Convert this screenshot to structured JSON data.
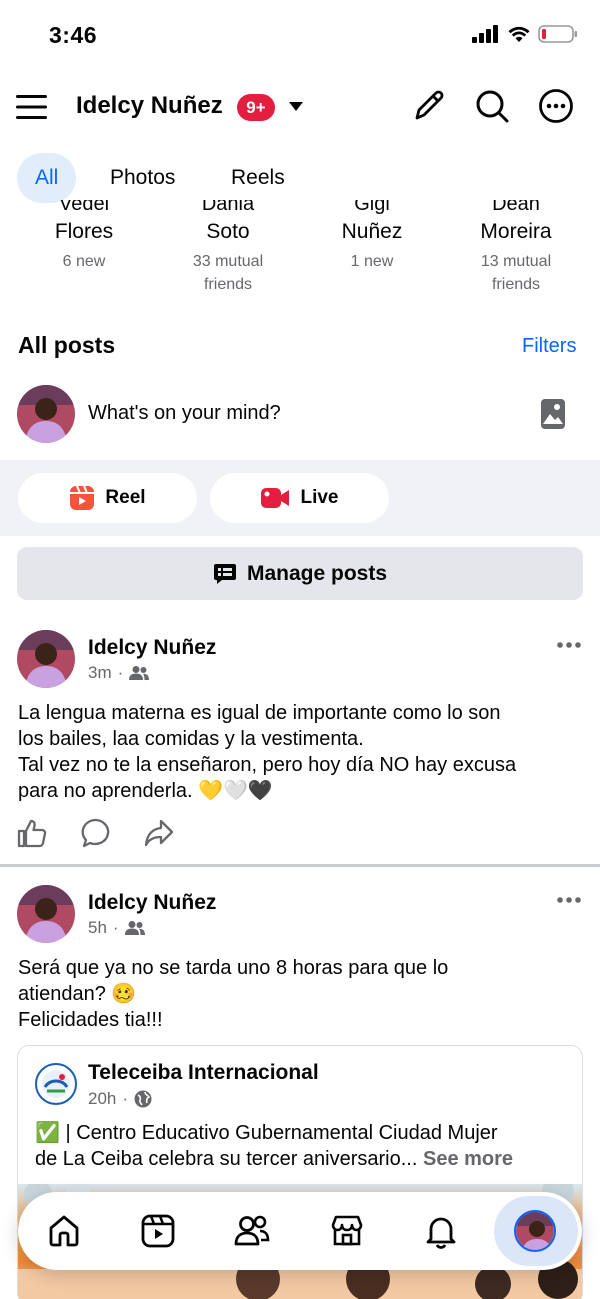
{
  "status_bar": {
    "time": "3:46"
  },
  "header": {
    "title": "Idelcy Nuñez",
    "badge": "9+"
  },
  "tabs": [
    {
      "label": "All",
      "active": true
    },
    {
      "label": "Photos",
      "active": false
    },
    {
      "label": "Reels",
      "active": false
    }
  ],
  "suggestions": [
    {
      "first": "Vedel",
      "last": "Flores",
      "sub1": "6 new",
      "sub2": ""
    },
    {
      "first": "Dania",
      "last": "Soto",
      "sub1": "33 mutual",
      "sub2": "friends"
    },
    {
      "first": "Gigi",
      "last": "Nuñez",
      "sub1": "1 new",
      "sub2": ""
    },
    {
      "first": "Dean",
      "last": "Moreira",
      "sub1": "13 mutual",
      "sub2": "friends"
    }
  ],
  "section": {
    "title": "All posts",
    "filters": "Filters"
  },
  "composer": {
    "placeholder": "What's on your mind?"
  },
  "actions": {
    "reel": "Reel",
    "live": "Live",
    "manage": "Manage posts"
  },
  "posts": [
    {
      "author": "Idelcy Nuñez",
      "time": "3m",
      "line1": "La lengua materna es igual de importante como lo son",
      "line2": "los bailes, laa comidas y la vestimenta.",
      "line3": "Tal vez no te la enseñaron, pero hoy día NO hay excusa",
      "line4": "para no aprenderla. 💛🤍🖤"
    },
    {
      "author": "Idelcy Nuñez",
      "time": "5h",
      "line1": "Será que ya no se tarda uno 8 horas para que lo",
      "line2": "atiendan? 🥴",
      "line3": "Felicidades tia!!!",
      "shared": {
        "page": "Teleceiba Internacional",
        "time": "20h",
        "line1": "✅ | Centro Educativo Gubernamental Ciudad Mujer",
        "line2": "de La Ceiba celebra su tercer aniversario...",
        "see_more": "See more"
      }
    }
  ],
  "colors": {
    "accent": "#0866ff",
    "badge": "#e41e3f",
    "reel": "#f5533d",
    "live": "#e41e3f"
  }
}
